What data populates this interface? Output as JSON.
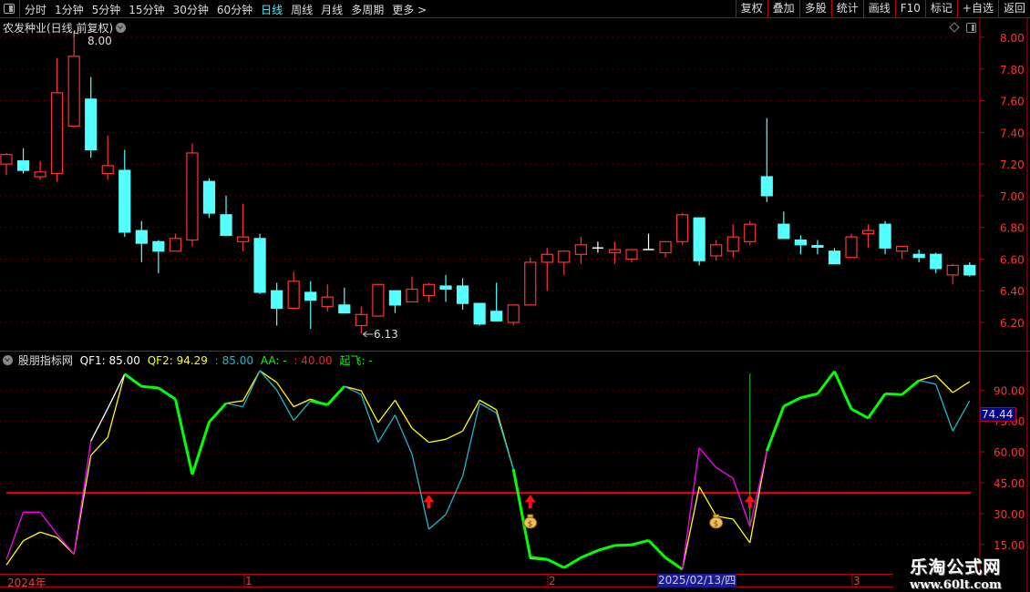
{
  "toolbar": {
    "periods": [
      "分时",
      "1分钟",
      "5分钟",
      "15分钟",
      "30分钟",
      "60分钟",
      "日线",
      "周线",
      "月线",
      "多周期",
      "更多 >"
    ],
    "active_period": "日线",
    "buttons": [
      "复权",
      "叠加",
      "多股",
      "统计",
      "画线",
      "F10",
      "标记",
      "+自选",
      "返回"
    ]
  },
  "stock": {
    "title": "农发种业(日线,前复权)",
    "high_label": "8.00",
    "low_label": "6.13"
  },
  "indicator": {
    "name": "股朋指标网",
    "qf1_label": "QF1:",
    "qf1": "85.00",
    "qf2_label": "QF2:",
    "qf2": "94.29",
    "v3": ": 85.00",
    "aa_label": "AA: -",
    "v4": ": 40.00",
    "qifei": "起飞: -",
    "current_value": "74.44"
  },
  "colors": {
    "up": "#ff3232",
    "down": "#54ffff",
    "yellow": "#ffff00",
    "green": "#00ff00",
    "magenta": "#ff00ff",
    "cyan": "#20b8c8",
    "grid": "#8b0000",
    "axis": "#c00000"
  },
  "price_axis": [
    "8.00",
    "7.80",
    "7.60",
    "7.40",
    "7.20",
    "7.00",
    "6.80",
    "6.60",
    "6.40",
    "6.20"
  ],
  "ind_axis": [
    "90.00",
    "75.00",
    "60.00",
    "45.00",
    "30.00",
    "15.00"
  ],
  "time_axis": {
    "labels": [
      "2024年",
      "1",
      "2",
      "3"
    ],
    "selected_date": "2025/02/13/四"
  },
  "watermark": {
    "title": "乐淘公式网",
    "url": "www.60lt.com"
  },
  "chart_data": [
    {
      "type": "candlestick",
      "ylim": [
        6.1,
        8.05
      ],
      "ohlc": [
        [
          7.2,
          7.27,
          7.13,
          7.26
        ],
        [
          7.22,
          7.3,
          7.14,
          7.16
        ],
        [
          7.12,
          7.22,
          7.1,
          7.15
        ],
        [
          7.14,
          7.87,
          7.09,
          7.65
        ],
        [
          7.44,
          8.0,
          7.43,
          7.88
        ],
        [
          7.61,
          7.75,
          7.24,
          7.29
        ],
        [
          7.14,
          7.38,
          7.1,
          7.19
        ],
        [
          7.16,
          7.29,
          6.74,
          6.77
        ],
        [
          6.78,
          6.84,
          6.58,
          6.7
        ],
        [
          6.71,
          6.72,
          6.51,
          6.65
        ],
        [
          6.65,
          6.76,
          6.65,
          6.73
        ],
        [
          6.72,
          7.33,
          6.68,
          7.27
        ],
        [
          7.09,
          7.11,
          6.86,
          6.89
        ],
        [
          6.88,
          7.0,
          6.75,
          6.75
        ],
        [
          6.71,
          6.95,
          6.65,
          6.74
        ],
        [
          6.73,
          6.76,
          6.38,
          6.39
        ],
        [
          6.4,
          6.45,
          6.18,
          6.29
        ],
        [
          6.29,
          6.52,
          6.29,
          6.46
        ],
        [
          6.39,
          6.46,
          6.16,
          6.34
        ],
        [
          6.3,
          6.44,
          6.27,
          6.36
        ],
        [
          6.31,
          6.42,
          6.26,
          6.26
        ],
        [
          6.18,
          6.3,
          6.13,
          6.25
        ],
        [
          6.24,
          6.44,
          6.24,
          6.44
        ],
        [
          6.4,
          6.4,
          6.26,
          6.31
        ],
        [
          6.33,
          6.49,
          6.33,
          6.41
        ],
        [
          6.37,
          6.45,
          6.33,
          6.44
        ],
        [
          6.43,
          6.5,
          6.33,
          6.41
        ],
        [
          6.43,
          6.48,
          6.28,
          6.32
        ],
        [
          6.32,
          6.32,
          6.18,
          6.19
        ],
        [
          6.27,
          6.45,
          6.21,
          6.21
        ],
        [
          6.2,
          6.31,
          6.18,
          6.31
        ],
        [
          6.31,
          6.61,
          6.31,
          6.58
        ],
        [
          6.58,
          6.67,
          6.4,
          6.63
        ],
        [
          6.58,
          6.65,
          6.5,
          6.65
        ],
        [
          6.63,
          6.74,
          6.57,
          6.69
        ],
        [
          6.67,
          6.71,
          6.64,
          6.67
        ],
        [
          6.64,
          6.71,
          6.57,
          6.66
        ],
        [
          6.6,
          6.66,
          6.58,
          6.66
        ],
        [
          6.66,
          6.76,
          6.66,
          6.66
        ],
        [
          6.64,
          6.71,
          6.61,
          6.71
        ],
        [
          6.71,
          6.89,
          6.69,
          6.88
        ],
        [
          6.86,
          6.86,
          6.56,
          6.59
        ],
        [
          6.62,
          6.72,
          6.59,
          6.69
        ],
        [
          6.65,
          6.82,
          6.61,
          6.74
        ],
        [
          6.71,
          6.84,
          6.69,
          6.82
        ],
        [
          7.12,
          7.49,
          6.96,
          7.0
        ],
        [
          6.82,
          6.9,
          6.73,
          6.73
        ],
        [
          6.72,
          6.75,
          6.63,
          6.69
        ],
        [
          6.685,
          6.72,
          6.63,
          6.675
        ],
        [
          6.65,
          6.67,
          6.57,
          6.57
        ],
        [
          6.61,
          6.76,
          6.61,
          6.74
        ],
        [
          6.76,
          6.82,
          6.67,
          6.78
        ],
        [
          6.82,
          6.84,
          6.63,
          6.67
        ],
        [
          6.65,
          6.68,
          6.6,
          6.68
        ],
        [
          6.63,
          6.66,
          6.58,
          6.61
        ],
        [
          6.63,
          6.64,
          6.51,
          6.54
        ],
        [
          6.5,
          6.57,
          6.44,
          6.56
        ],
        [
          6.56,
          6.58,
          6.49,
          6.5
        ]
      ]
    },
    {
      "type": "line",
      "ylim": [
        0,
        105
      ],
      "threshold": 40,
      "series": [
        {
          "name": "QF1",
          "values": [
            7.7,
            30.7,
            30.7,
            19.9,
            10.3,
            65.2,
            81.1,
            97.8,
            91.8,
            91.0,
            85.6,
            49.0,
            74.5,
            83.6,
            81.9,
            99.4,
            90.0,
            75.2,
            84.8,
            82.9,
            91.8,
            87.8,
            64.6,
            77.9,
            59.0,
            22.4,
            29.5,
            48.2,
            83.6,
            78.9,
            51.6,
            8.8,
            7.8,
            3.7,
            8.6,
            12.1,
            14.5,
            14.8,
            17.0,
            8.6,
            2.9,
            61.9,
            52.4,
            47.2,
            23.6,
            60.5,
            82.2,
            86.3,
            88.2,
            99.1,
            80.8,
            76.4,
            88.2,
            87.8,
            94.7,
            92.9,
            70.1,
            84.8
          ]
        },
        {
          "name": "QF2",
          "values": [
            5.0,
            16.8,
            21.0,
            18.4,
            10.3,
            58.3,
            67.1,
            97.8,
            91.8,
            91.0,
            85.6,
            49.0,
            74.5,
            83.6,
            84.8,
            99.4,
            93.7,
            81.9,
            85.6,
            82.9,
            91.8,
            89.7,
            74.2,
            85.1,
            71.5,
            64.6,
            66.1,
            70.1,
            85.1,
            80.4,
            51.6,
            8.1,
            7.4,
            3.7,
            8.6,
            12.1,
            14.5,
            14.8,
            17.0,
            8.6,
            2.9,
            43.1,
            28.8,
            27.3,
            15.8,
            60.5,
            82.2,
            86.3,
            88.2,
            99.1,
            80.8,
            76.4,
            88.2,
            87.8,
            94.7,
            97.1,
            88.8,
            94.1
          ]
        }
      ],
      "buy_arrows": [
        25,
        31,
        44
      ],
      "money_bags": [
        31,
        42
      ],
      "signal_line": 44
    }
  ]
}
